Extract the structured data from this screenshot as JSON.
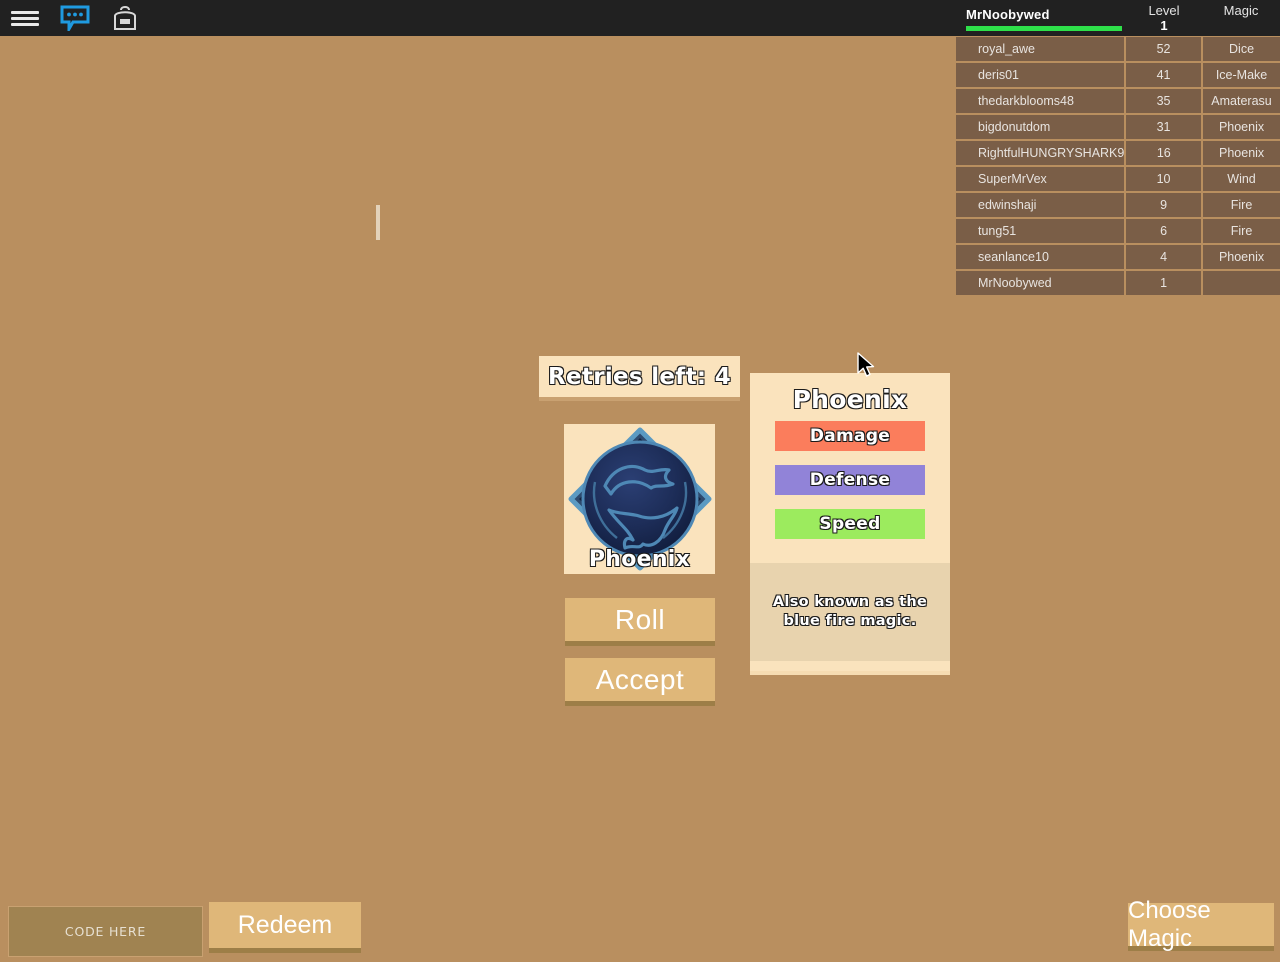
{
  "topbar": {
    "background": "#212121",
    "icons": [
      {
        "name": "menu-icon",
        "glyph": "hamburger"
      },
      {
        "name": "chat-icon",
        "glyph": "chat-bubble"
      },
      {
        "name": "backpack-icon",
        "glyph": "backpack"
      }
    ]
  },
  "leaderboard": {
    "player_name": "MrNoobywed",
    "underline_color": "#2ee04a",
    "columns": {
      "name": "",
      "level": "Level",
      "level_value": "1",
      "magic": "Magic"
    },
    "rows": [
      {
        "name": "royal_awe",
        "level": "52",
        "magic": "Dice"
      },
      {
        "name": "deris01",
        "level": "41",
        "magic": "Ice-Make"
      },
      {
        "name": "thedarkblooms48",
        "level": "35",
        "magic": "Amaterasu"
      },
      {
        "name": "bigdonutdom",
        "level": "31",
        "magic": "Phoenix"
      },
      {
        "name": "RightfulHUNGRYSHARK9",
        "level": "16",
        "magic": "Phoenix"
      },
      {
        "name": "SuperMrVex",
        "level": "10",
        "magic": "Wind"
      },
      {
        "name": "edwinshaji",
        "level": "9",
        "magic": "Fire"
      },
      {
        "name": "tung51",
        "level": "6",
        "magic": "Fire"
      },
      {
        "name": "seanlance10",
        "level": "4",
        "magic": "Phoenix"
      },
      {
        "name": "MrNoobywed",
        "level": "1",
        "magic": ""
      }
    ]
  },
  "roll": {
    "retries_label": "Retries left: 4",
    "card_label": "Phoenix",
    "roll_button": "Roll",
    "accept_button": "Accept",
    "emblem": {
      "name": "phoenix-emblem",
      "frame_color": "#5b9ac2",
      "orb_color": "#1b2a52",
      "motif_color": "#4e88b5"
    }
  },
  "magic_panel": {
    "title": "Phoenix",
    "stats": [
      {
        "label": "Damage",
        "color": "#fb7d5c"
      },
      {
        "label": "Defense",
        "color": "#9183d8"
      },
      {
        "label": "Speed",
        "color": "#9ceb5e"
      }
    ],
    "description": "Also known as the blue fire magic."
  },
  "bottom": {
    "code_placeholder": "CODE HERE",
    "redeem_button": "Redeem",
    "choose_magic_button": "Choose Magic"
  },
  "theme": {
    "background": "#b98f5f",
    "panel_cream": "#fae3bd",
    "panel_cream_dark": "#e8d3ae",
    "button_tan": "#dfb779",
    "button_shadow": "#9d7e47",
    "row_brown": "#7a5e47"
  }
}
